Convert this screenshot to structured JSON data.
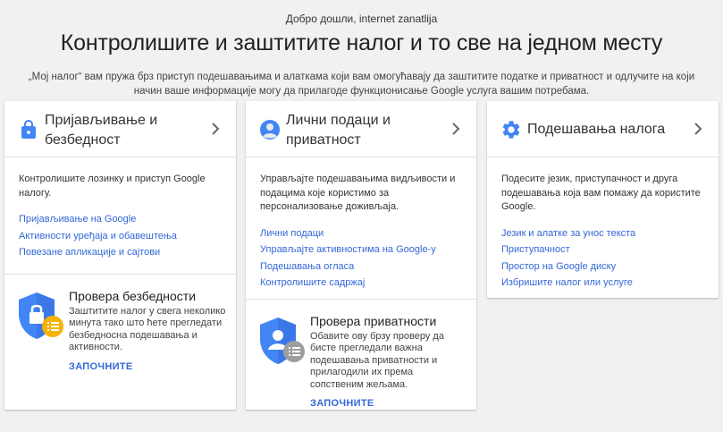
{
  "header": {
    "welcome": "Добро дошли, internet zanatlija",
    "headline": "Контролишите и заштитите налог и то све на једном месту",
    "intro": "„Мој налог“ вам пружа брз приступ подешавањима и алаткама који вам омогућавају да заштитите податке и приватност и одлучите на који начин ваше информације могу да прилагоде функционисање Google услуга вашим потребама."
  },
  "cards": [
    {
      "title": "Пријављивање и безбедност",
      "icon": "lock-icon",
      "description": "Контролишите лозинку и приступ Google налогу.",
      "links": [
        "Пријављивање на Google",
        "Активности уређаја и обавештења",
        "Повезане апликације и сајтови"
      ],
      "check": {
        "title": "Провера безбедности",
        "description": "Заштитите налог у свега неколико минута тако што ћете прегледати безбедносна подешавања и активности.",
        "action": "ЗАПОЧНИТЕ",
        "icon": "security-shield-icon"
      }
    },
    {
      "title": "Лични подаци и приватност",
      "icon": "person-icon",
      "description": "Управљајте подешавањима видљивости и подацима које користимо за персонализовање доживљаја.",
      "links": [
        "Лични подаци",
        "Управљајте активностима на Google-у",
        "Подешавања огласа",
        "Контролишите садржај"
      ],
      "check": {
        "title": "Провера приватности",
        "description": "Обавите ову брзу проверу да бисте прегледали важна подешавања приватности и прилагодили их према сопственим жељама.",
        "action": "ЗАПОЧНИТЕ",
        "icon": "privacy-shield-icon"
      }
    },
    {
      "title": "Подешавања налога",
      "icon": "gear-icon",
      "description": "Подесите језик, приступачност и друга подешавања која вам помажу да користите Google.",
      "links": [
        "Језик и алатке за унос текста",
        "Приступачност",
        "Простор на Google диску",
        "Избришите налог или услуге"
      ]
    }
  ],
  "colors": {
    "accent": "#4285f4",
    "link": "#3367d6",
    "badge": "#f4b400",
    "background": "#f1f1f1"
  }
}
